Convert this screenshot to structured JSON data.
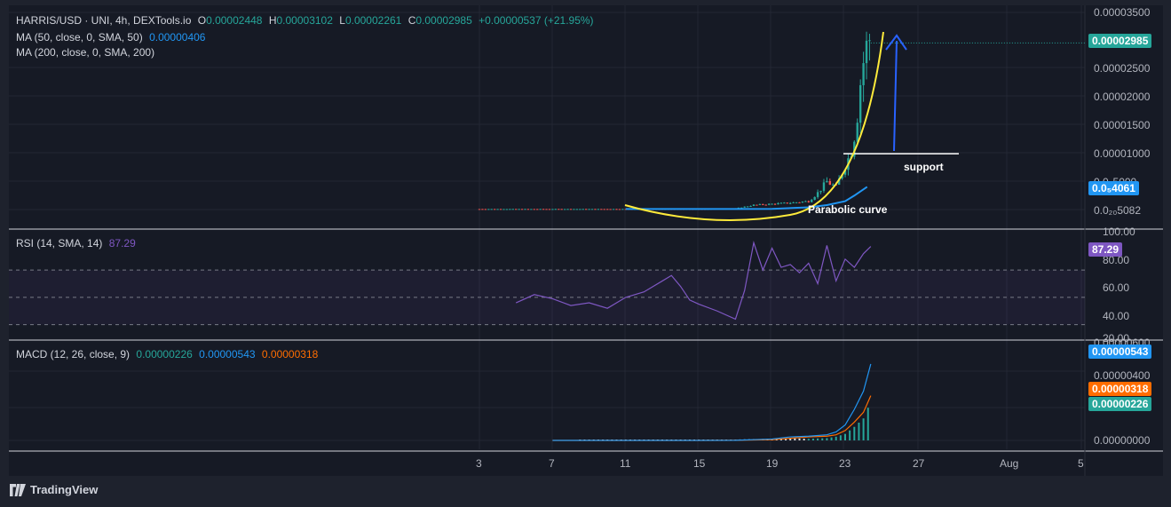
{
  "header": {
    "symbol": "HARRIS/USD · UNI, 4h, DEXTools.io",
    "o_label": "O",
    "o_value": "0.00002448",
    "h_label": "H",
    "h_value": "0.00003102",
    "l_label": "L",
    "l_value": "0.00002261",
    "c_label": "C",
    "c_value": "0.00002985",
    "change": "+0.00000537 (+21.95%)"
  },
  "ma50": {
    "label": "MA (50, close, 0, SMA, 50)",
    "value": "0.00000406"
  },
  "ma200": {
    "label": "MA (200, close, 0, SMA, 200)"
  },
  "rsi": {
    "label": "RSI (14, SMA, 14)",
    "value": "87.29"
  },
  "macd": {
    "label": "MACD (12, 26, close, 9)",
    "hist": "0.00000226",
    "macd": "0.00000543",
    "signal": "0.00000318"
  },
  "annotations": {
    "support": "support",
    "parabolic": "Parabolic curve"
  },
  "price_axis": [
    "0.00003500",
    "0.00002500",
    "0.00002000",
    "0.00001500",
    "0.00001000",
    "0.0₅5000",
    "0.0₂₀5082"
  ],
  "price_tags": {
    "last": "0.00002985",
    "ma50": "0.0₅4061"
  },
  "rsi_axis": [
    "100.00",
    "80.00",
    "60.00",
    "40.00",
    "20.00"
  ],
  "macd_axis": [
    "0.00000600",
    "0.00000400",
    "0.00000000"
  ],
  "macd_tags": {
    "macd": "0.00000543",
    "signal": "0.00000318",
    "hist": "0.00000226"
  },
  "time_axis": [
    "3",
    "7",
    "11",
    "15",
    "19",
    "23",
    "27",
    "Aug",
    "5"
  ],
  "footer": {
    "brand": "TradingView"
  },
  "colors": {
    "up": "#26a69a",
    "down": "#ef5350",
    "ma50": "#2196f3",
    "rsi": "#7e57c2",
    "macd": "#2196f3",
    "signal": "#ff6d00",
    "parabola": "#ffeb3b",
    "arrow": "#2962ff"
  },
  "chart_data": [
    {
      "type": "candlestick",
      "title": "HARRIS/USD · UNI, 4h, DEXTools.io",
      "x_ticks": [
        "3",
        "7",
        "11",
        "15",
        "19",
        "23",
        "27",
        "Aug",
        "5"
      ],
      "ylim": [
        0,
        3.5e-05
      ],
      "series": [
        {
          "name": "MA (50, close, 0, SMA, 50)",
          "x": [
            11,
            13,
            15,
            17,
            19,
            21,
            22,
            23,
            23.5,
            24.2
          ],
          "values": [
            1e-07,
            1e-07,
            1e-07,
            1e-07,
            1.2e-07,
            4e-07,
            8e-07,
            1.5e-06,
            2.5e-06,
            4.06e-06
          ]
        }
      ],
      "approx_close": {
        "x": [
          3,
          7,
          11,
          15,
          17,
          18,
          19,
          20,
          21,
          21.5,
          22,
          22.5,
          23,
          23.3,
          23.6,
          23.9,
          24.1,
          24.3,
          24.4
        ],
        "values": [
          1e-07,
          1e-07,
          1e-07,
          1e-07,
          2e-07,
          8e-07,
          1e-06,
          1.2e-06,
          1.5e-06,
          3e-06,
          5e-06,
          4e-06,
          8e-06,
          1e-05,
          1.5e-05,
          2.5e-05,
          2.8e-05,
          3.1e-05,
          2.985e-05
        ]
      },
      "levels": [
        {
          "name": "support",
          "value": 1e-05
        }
      ],
      "last": 2.985e-05
    },
    {
      "type": "line",
      "title": "RSI (14, SMA, 14)",
      "ylim": [
        20,
        100
      ],
      "x": [
        5,
        6,
        7,
        8,
        9,
        10,
        11,
        12,
        13,
        13.5,
        14,
        14.5,
        15,
        16,
        17,
        17.5,
        18,
        18.5,
        19,
        19.5,
        20,
        20.5,
        21,
        21.5,
        22,
        22.5,
        23,
        23.5,
        24,
        24.4
      ],
      "values": [
        46,
        52,
        49,
        44,
        46,
        42,
        50,
        54,
        62,
        66,
        58,
        48,
        45,
        40,
        34,
        55,
        90,
        70,
        86,
        72,
        74,
        68,
        75,
        60,
        88,
        62,
        78,
        72,
        82,
        87.29
      ]
    },
    {
      "type": "line",
      "title": "MACD (12, 26, close, 9)",
      "ylim": [
        0,
        6.5e-06
      ],
      "x": [
        7,
        11,
        15,
        17,
        19,
        20,
        21,
        22,
        22.5,
        23,
        23.5,
        24,
        24.4
      ],
      "series": [
        {
          "name": "MACD",
          "values": [
            0,
            0,
            0,
            1e-08,
            1e-07,
            2.5e-07,
            3e-07,
            4e-07,
            6e-07,
            1.1e-06,
            2.2e-06,
            3.5e-06,
            5.43e-06
          ]
        },
        {
          "name": "Signal",
          "values": [
            0,
            0,
            0,
            1e-08,
            5e-08,
            1.5e-07,
            2.5e-07,
            3e-07,
            4e-07,
            7e-07,
            1.3e-06,
            2e-06,
            3.18e-06
          ]
        },
        {
          "name": "Histogram",
          "values": [
            0,
            0,
            0,
            0,
            5e-08,
            1e-07,
            5e-08,
            1e-07,
            2e-07,
            4e-07,
            9e-07,
            1.5e-06,
            2.26e-06
          ]
        }
      ]
    }
  ]
}
